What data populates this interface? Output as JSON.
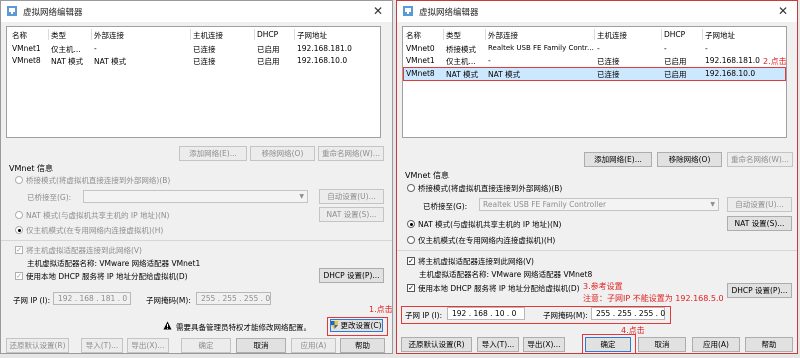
{
  "colors": {
    "accent": "#2b7ad7",
    "annotation": "#e02020",
    "selected_row": "#cce8ff"
  },
  "left": {
    "title": "虚拟网络编辑器",
    "close": "✕",
    "columns": [
      "名称",
      "类型",
      "外部连接",
      "主机连接",
      "DHCP",
      "子网地址"
    ],
    "rows": [
      [
        "VMnet1",
        "仅主机...",
        "-",
        "已连接",
        "已启用",
        "192.168.181.0"
      ],
      [
        "VMnet8",
        "NAT 模式",
        "NAT 模式",
        "已连接",
        "已启用",
        "192.168.10.0"
      ]
    ],
    "buttons": {
      "add": "添加网络(E)...",
      "remove": "移除网络(O)",
      "rename": "重命名网络(W)..."
    },
    "vmnet_info": "VMnet 信息",
    "bridged": "桥接模式(将虚拟机直接连接到外部网络)(B)",
    "bridged_to": "已桥接至(G):",
    "bridged_value": "",
    "auto_settings": "自动设置(U)...",
    "nat": "NAT 模式(与虚拟机共享主机的 IP 地址)(N)",
    "nat_settings": "NAT 设置(S)...",
    "hostonly": "仅主机模式(在专用网络内连接虚拟机)(H)",
    "connect_adapter": "将主机虚拟适配器连接到此网络(V)",
    "adapter_name": "主机虚拟适配器名称: VMware 网络适配器 VMnet1",
    "dhcp": "使用本地 DHCP 服务将 IP 地址分配给虚拟机(D)",
    "dhcp_settings": "DHCP 设置(P)...",
    "subnet_ip_label": "子网 IP (I):",
    "subnet_ip": "192 . 168 . 181 .  0",
    "mask_label": "子网掩码(M):",
    "mask": "255 . 255 . 255 .  0",
    "admin_note": "需要具备管理员特权才能修改网络配置。",
    "change_settings": "更改设置(C)",
    "restore": "还原默认设置(R)",
    "import": "导入(T)...",
    "export": "导出(X)...",
    "ok": "确定",
    "cancel": "取消",
    "apply": "应用(A)",
    "help": "帮助",
    "ann1": "1.点击"
  },
  "right": {
    "title": "虚拟网络编辑器",
    "close": "✕",
    "columns": [
      "名称",
      "类型",
      "外部连接",
      "主机连接",
      "DHCP",
      "子网地址"
    ],
    "rows": [
      [
        "VMnet0",
        "桥接模式",
        "Realtek USB FE Family Contr...",
        "-",
        "-",
        "-"
      ],
      [
        "VMnet1",
        "仅主机...",
        "-",
        "已连接",
        "已启用",
        "192.168.181.0"
      ],
      [
        "VMnet8",
        "NAT 模式",
        "NAT 模式",
        "已连接",
        "已启用",
        "192.168.10.0"
      ]
    ],
    "buttons": {
      "add": "添加网络(E)...",
      "remove": "移除网络(O)",
      "rename": "重命名网络(W)..."
    },
    "vmnet_info": "VMnet 信息",
    "bridged": "桥接模式(将虚拟机直接连接到外部网络)(B)",
    "bridged_to": "已桥接至(G):",
    "bridged_value": "Realtek USB FE Family Controller",
    "auto_settings": "自动设置(U)...",
    "nat": "NAT 模式(与虚拟机共享主机的 IP 地址)(N)",
    "nat_settings": "NAT 设置(S)...",
    "hostonly": "仅主机模式(在专用网络内连接虚拟机)(H)",
    "connect_adapter": "将主机虚拟适配器连接到此网络(V)",
    "adapter_name": "主机虚拟适配器名称: VMware 网络适配器 VMnet8",
    "dhcp": "使用本地 DHCP 服务将 IP 地址分配给虚拟机(D)",
    "dhcp_settings": "DHCP 设置(P)...",
    "subnet_ip_label": "子网 IP (I):",
    "subnet_ip": "192 . 168 . 10 .  0",
    "mask_label": "子网掩码(M):",
    "mask": "255 . 255 . 255 .  0",
    "restore": "还原默认设置(R)",
    "import": "导入(T)...",
    "export": "导出(X)...",
    "ok": "确定",
    "cancel": "取消",
    "apply": "应用(A)",
    "help": "帮助",
    "ann2": "2.点击",
    "ann3": "3.参考设置",
    "ann_note": "注意：子网IP 不能设置为 192.168.5.0",
    "ann4": "4.点击"
  }
}
